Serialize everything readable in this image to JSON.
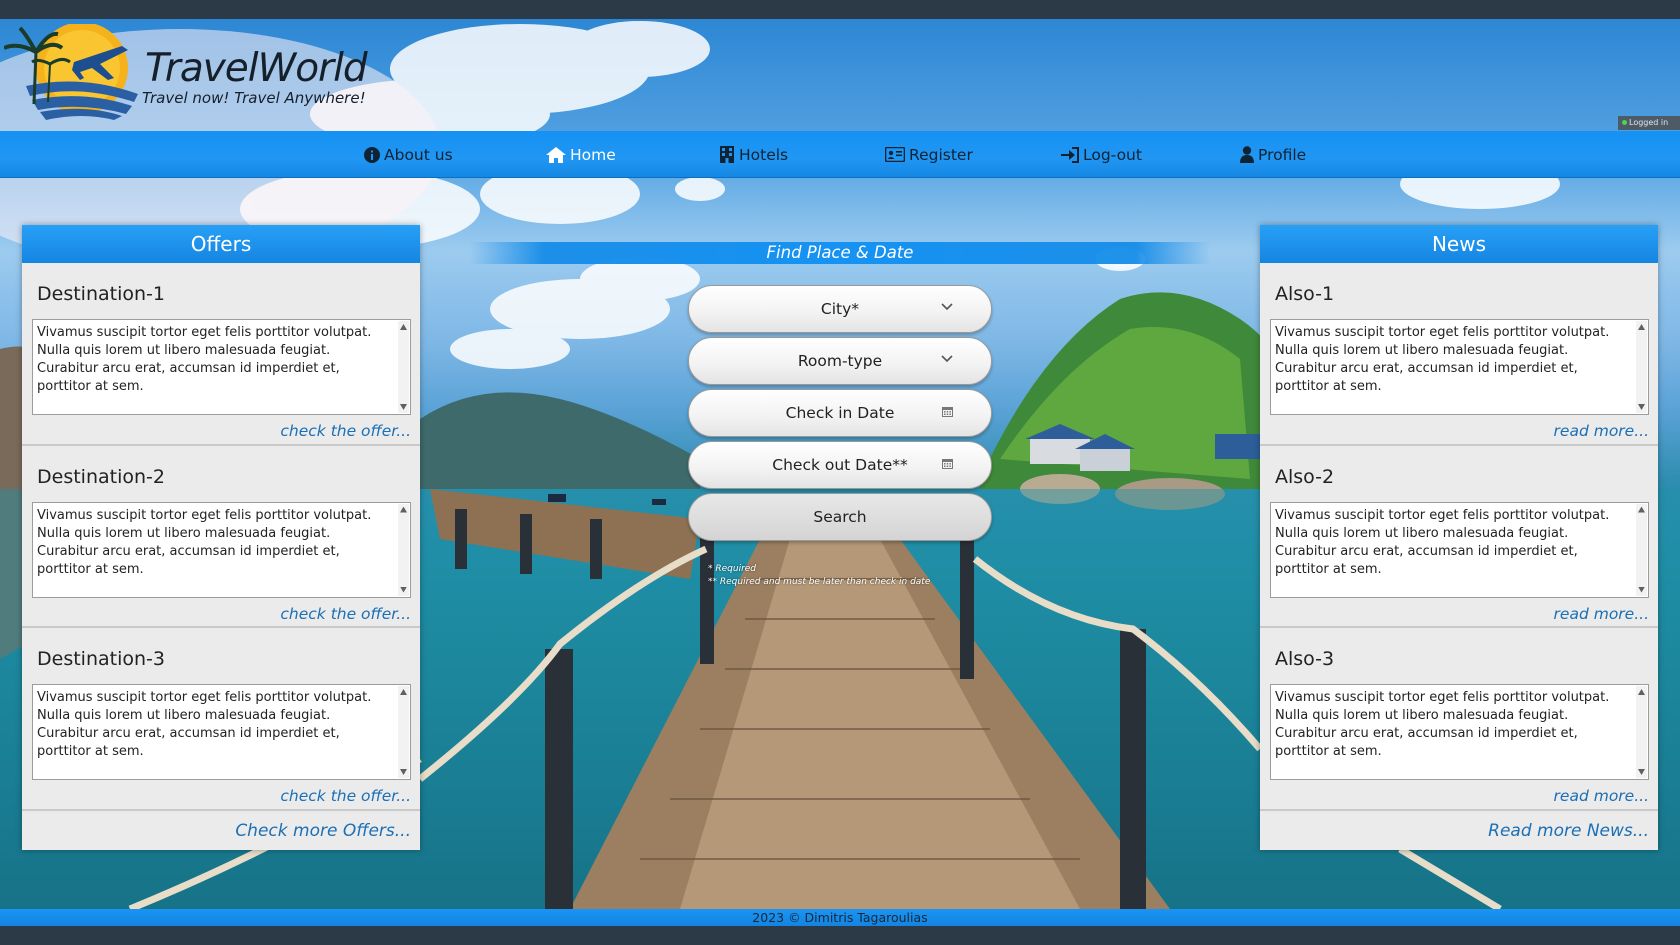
{
  "header": {
    "logo_title": "TravelWorld",
    "logo_tagline": "Travel now! Travel Anywhere!",
    "logged_status": "Logged in"
  },
  "nav": {
    "items": [
      {
        "label": "About us",
        "icon": "info-icon"
      },
      {
        "label": "Home",
        "icon": "home-icon"
      },
      {
        "label": "Hotels",
        "icon": "hotel-icon"
      },
      {
        "label": "Register",
        "icon": "id-card-icon"
      },
      {
        "label": "Log-out",
        "icon": "logout-icon"
      },
      {
        "label": "Profile",
        "icon": "user-icon"
      }
    ]
  },
  "offers": {
    "title": "Offers",
    "cards": [
      {
        "title": "Destination-1",
        "text": "Vivamus suscipit tortor eget felis porttitor volutpat. Nulla quis lorem ut libero malesuada feugiat. Curabitur arcu erat, accumsan id imperdiet et, porttitor at sem.",
        "link": "check the offer..."
      },
      {
        "title": "Destination-2",
        "text": "Vivamus suscipit tortor eget felis porttitor volutpat. Nulla quis lorem ut libero malesuada feugiat. Curabitur arcu erat, accumsan id imperdiet et, porttitor at sem.",
        "link": "check the offer..."
      },
      {
        "title": "Destination-3",
        "text": "Vivamus suscipit tortor eget felis porttitor volutpat. Nulla quis lorem ut libero malesuada feugiat. Curabitur arcu erat, accumsan id imperdiet et, porttitor at sem.",
        "link": "check the offer..."
      }
    ],
    "more_link": "Check more Offers..."
  },
  "news": {
    "title": "News",
    "cards": [
      {
        "title": "Also-1",
        "text": "Vivamus suscipit tortor eget felis porttitor volutpat. Nulla quis lorem ut libero malesuada feugiat. Curabitur arcu erat, accumsan id imperdiet et, porttitor at sem.",
        "link": "read more..."
      },
      {
        "title": "Also-2",
        "text": "Vivamus suscipit tortor eget felis porttitor volutpat. Nulla quis lorem ut libero malesuada feugiat. Curabitur arcu erat, accumsan id imperdiet et, porttitor at sem.",
        "link": "read more..."
      },
      {
        "title": "Also-3",
        "text": "Vivamus suscipit tortor eget felis porttitor volutpat. Nulla quis lorem ut libero malesuada feugiat. Curabitur arcu erat, accumsan id imperdiet et, porttitor at sem.",
        "link": "read more..."
      }
    ],
    "more_link": "Read more News..."
  },
  "search": {
    "title": "Find Place & Date",
    "city_label": "City*",
    "room_label": "Room-type",
    "checkin_label": "Check in Date",
    "checkout_label": "Check out Date**",
    "button_label": "Search",
    "note_required": "* Required",
    "note_later": "** Required and must be later than check in date"
  },
  "footer": {
    "text": "2023 © Dimitris Tagaroulias"
  },
  "colors": {
    "nav_blue": "#2196f3",
    "dark_bar": "#2c3a48",
    "link_blue": "#1b6fb5",
    "panel_bg": "#e9e9e9"
  }
}
